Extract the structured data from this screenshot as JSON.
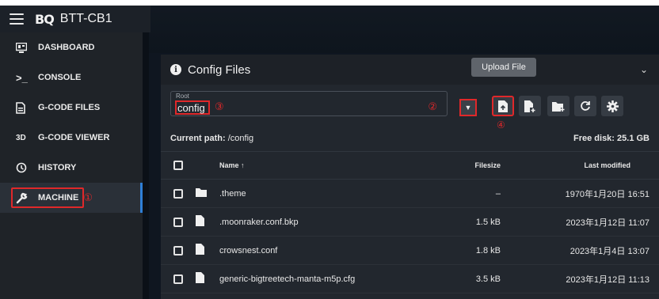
{
  "header": {
    "logo": "BQ",
    "title": "BTT-CB1"
  },
  "sidebar": {
    "items": [
      {
        "label": "DASHBOARD",
        "icon": "dashboard-icon"
      },
      {
        "label": "CONSOLE",
        "icon": "console-icon"
      },
      {
        "label": "G-CODE FILES",
        "icon": "file-icon"
      },
      {
        "label": "G-CODE VIEWER",
        "icon": "3d-icon",
        "icon_text": "3D"
      },
      {
        "label": "HISTORY",
        "icon": "history-icon"
      },
      {
        "label": "MACHINE",
        "icon": "wrench-icon",
        "active": true,
        "annotation": "①"
      }
    ]
  },
  "panel": {
    "title": "Config Files",
    "root_label": "Root",
    "root_value": "config",
    "annotation_root": "③",
    "annotation_dropdown": "②",
    "annotation_upload": "④",
    "tooltip": "Upload File",
    "current_path_label": "Current path:",
    "current_path": "/config",
    "free_disk_label": "Free disk:",
    "free_disk": "25.1 GB",
    "columns": {
      "name": "Name ↑",
      "size": "Filesize",
      "modified": "Last modified"
    },
    "rows": [
      {
        "type": "folder",
        "name": ".theme",
        "size": "–",
        "modified": "1970年1月20日 16:51"
      },
      {
        "type": "file",
        "name": ".moonraker.conf.bkp",
        "size": "1.5 kB",
        "modified": "2023年1月12日 11:07"
      },
      {
        "type": "file",
        "name": "crowsnest.conf",
        "size": "1.8 kB",
        "modified": "2023年1月4日 13:07"
      },
      {
        "type": "file",
        "name": "generic-bigtreetech-manta-m5p.cfg",
        "size": "3.5 kB",
        "modified": "2023年1月12日 11:13"
      }
    ]
  },
  "colors": {
    "accent": "#2f7fd6",
    "annotation": "#e0282a"
  }
}
